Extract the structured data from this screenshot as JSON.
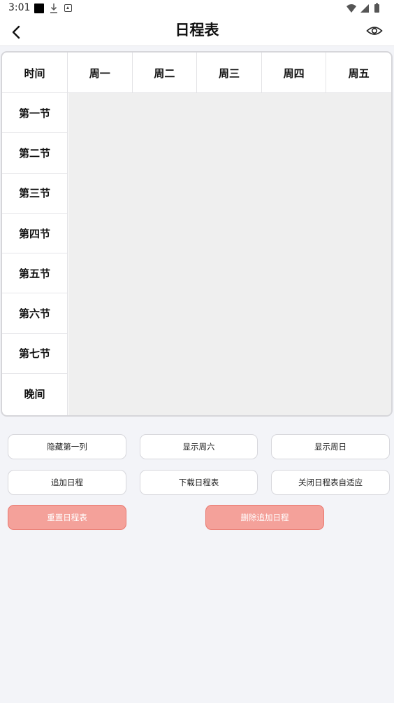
{
  "status_bar": {
    "time": "3:01",
    "icons": [
      "square-notification-icon",
      "download-icon",
      "a-notification-icon",
      "wifi-icon",
      "signal-icon",
      "battery-icon"
    ]
  },
  "header": {
    "title": "日程表",
    "back_icon": "chevron-left-icon",
    "eye_icon": "eye-icon"
  },
  "schedule": {
    "time_header": "时间",
    "days": [
      "周一",
      "周二",
      "周三",
      "周四",
      "周五"
    ],
    "periods": [
      "第一节",
      "第二节",
      "第三节",
      "第四节",
      "第五节",
      "第六节",
      "第七节",
      "晚间"
    ]
  },
  "actions": {
    "hide_first_col": "隐藏第一列",
    "show_saturday": "显示周六",
    "show_sunday": "显示周日",
    "add_schedule": "追加日程",
    "download_schedule": "下载日程表",
    "close_adaptive": "关闭日程表自适应",
    "reset_schedule": "重置日程表",
    "delete_added": "删除追加日程"
  },
  "colors": {
    "danger_fill": "#f4a19a",
    "danger_border": "#e9786f",
    "page_background": "#f3f4f8",
    "grid_background": "#efefef"
  }
}
